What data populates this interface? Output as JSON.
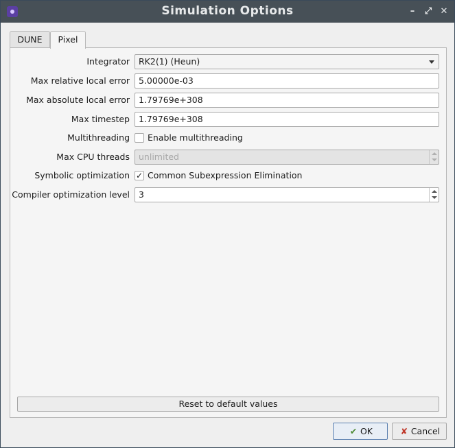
{
  "window": {
    "title": "Simulation Options",
    "controls": {
      "minimize": "–",
      "restore": "⤢",
      "close": "✕"
    }
  },
  "tabs": [
    {
      "label": "DUNE",
      "active": false
    },
    {
      "label": "Pixel",
      "active": true
    }
  ],
  "form": {
    "integrator": {
      "label": "Integrator",
      "value": "RK2(1) (Heun)"
    },
    "max_rel_error": {
      "label": "Max relative local error",
      "value": "5.00000e-03"
    },
    "max_abs_error": {
      "label": "Max absolute local error",
      "value": "1.79769e+308"
    },
    "max_timestep": {
      "label": "Max timestep",
      "value": "1.79769e+308"
    },
    "multithreading": {
      "label": "Multithreading",
      "checkbox_label": "Enable multithreading",
      "checked": false
    },
    "max_cpu_threads": {
      "label": "Max CPU threads",
      "value": "unlimited",
      "disabled": true
    },
    "symbolic_opt": {
      "label": "Symbolic optimization",
      "checkbox_label": "Common Subexpression Elimination",
      "checked": true,
      "check_glyph": "✓"
    },
    "compiler_opt": {
      "label": "Compiler optimization level",
      "value": "3"
    }
  },
  "reset_button": "Reset to default values",
  "buttons": {
    "ok": {
      "label": "OK",
      "icon": "ok-icon"
    },
    "cancel": {
      "label": "Cancel",
      "icon": "cancel-icon"
    }
  },
  "colors": {
    "titlebar": "#475057",
    "ok_icon": "#4d8a35",
    "cancel_icon": "#c0392b"
  }
}
